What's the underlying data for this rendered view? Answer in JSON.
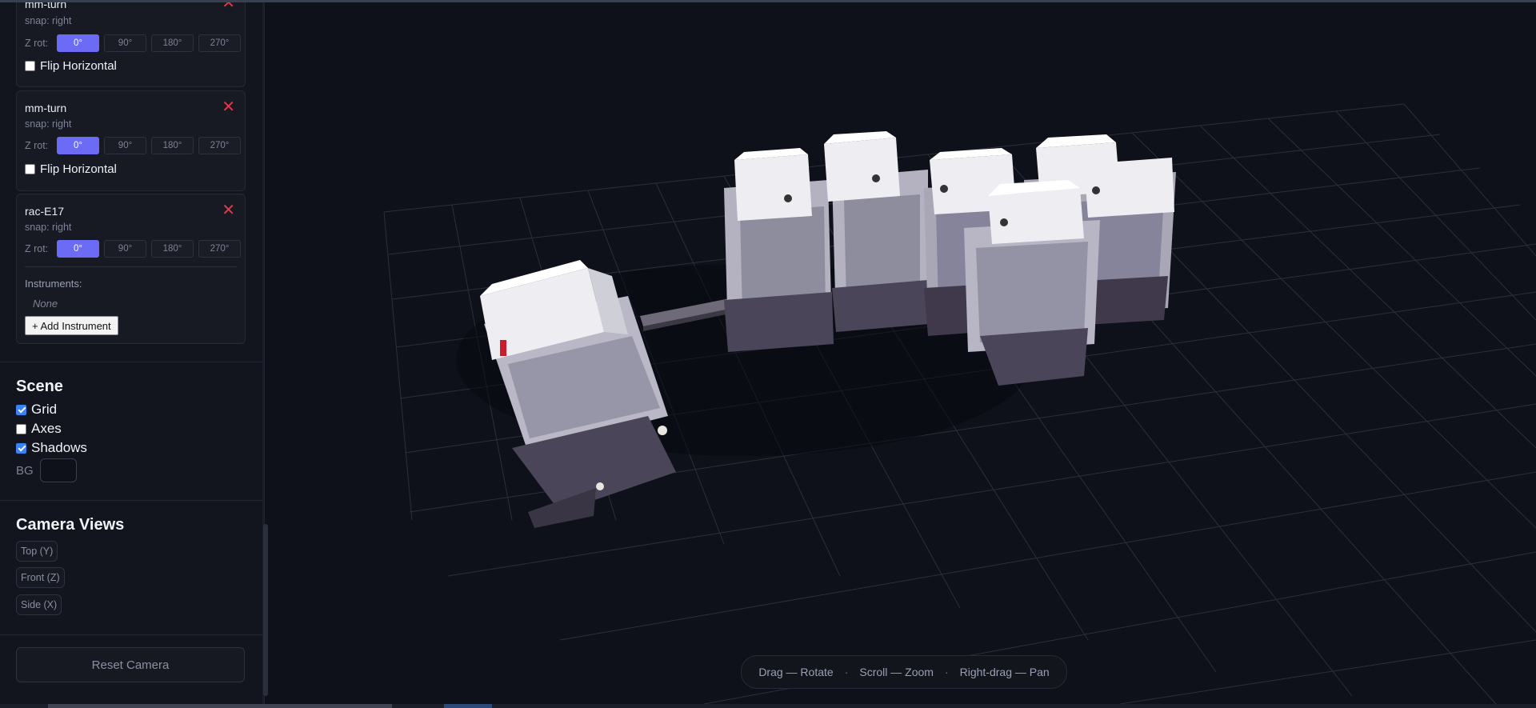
{
  "components": [
    {
      "name": "mm-turn",
      "snap": "snap: right",
      "zrot_label": "Z rot:",
      "flip_label": "Flip Horizontal",
      "flip_checked": false
    },
    {
      "name": "mm-turn",
      "snap": "snap: right",
      "zrot_label": "Z rot:",
      "flip_label": "Flip Horizontal",
      "flip_checked": false
    },
    {
      "name": "rac-E17",
      "snap": "snap: right",
      "zrot_label": "Z rot:",
      "instruments_label": "Instruments:",
      "instruments_none": "None",
      "add_instrument": "+ Add Instrument"
    }
  ],
  "rotations": [
    "0°",
    "90°",
    "180°",
    "270°"
  ],
  "selected_rotation": "0°",
  "close_icon": "close-icon",
  "scene": {
    "title": "Scene",
    "grid": {
      "label": "Grid",
      "checked": true
    },
    "axes": {
      "label": "Axes",
      "checked": false
    },
    "shadows": {
      "label": "Shadows",
      "checked": true
    },
    "bg_label": "BG",
    "bg_color": "#0e1119"
  },
  "camera": {
    "title": "Camera Views",
    "views": [
      "Top (Y)",
      "Front (Z)",
      "Side (X)"
    ],
    "reset": "Reset Camera"
  },
  "hint": {
    "rotate": "Drag — Rotate",
    "zoom": "Scroll — Zoom",
    "pan": "Right-drag — Pan",
    "sep": "·"
  },
  "colors": {
    "accent": "#6b6bf5",
    "danger": "#e0394a",
    "background": "#0e1119",
    "panel": "#12151d"
  }
}
